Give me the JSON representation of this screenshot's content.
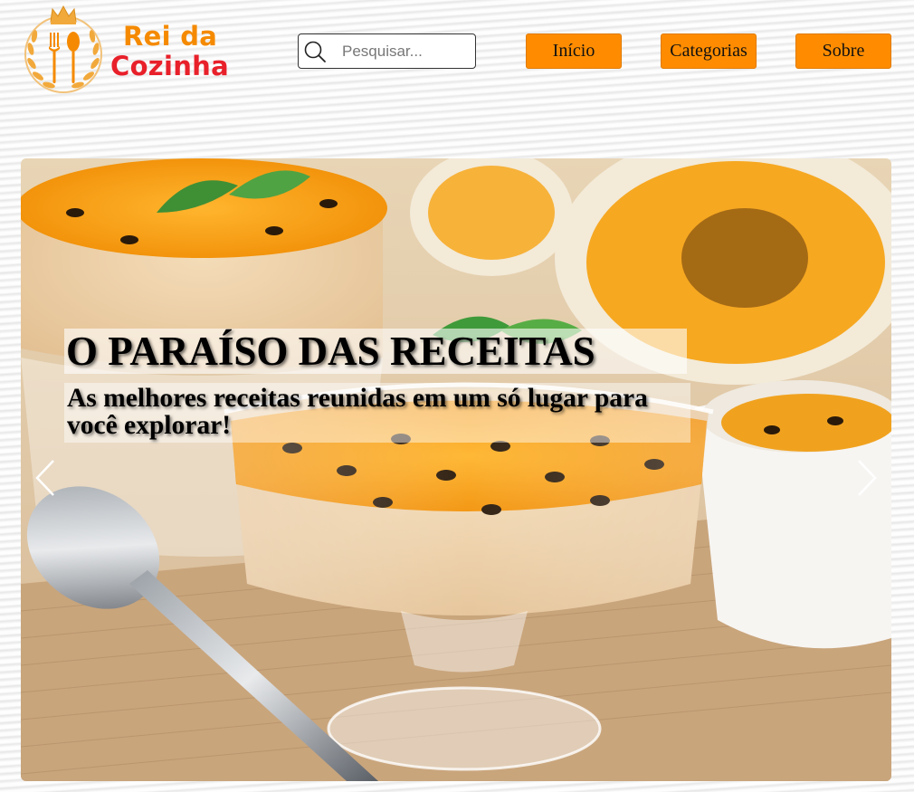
{
  "header": {
    "logo": {
      "line1": "Rei da",
      "line2": "Cozinha"
    },
    "search": {
      "placeholder": "Pesquisar..."
    },
    "nav": {
      "inicio": "Início",
      "categorias": "Categorias",
      "sobre": "Sobre"
    }
  },
  "hero": {
    "title": "O PARAÍSO DAS RECEITAS",
    "subtitle": "As melhores receitas reunidas em um só lugar para você explorar!",
    "prev_icon": "chevron-left-icon",
    "next_icon": "chevron-right-icon"
  },
  "colors": {
    "accent": "#ff8c00",
    "logo_orange": "#f58a00",
    "logo_red": "#e8202a",
    "emblem_gold": "#f2a93b"
  },
  "icons": {
    "search": "search-icon",
    "logo": "crown-fork-spoon-emblem-icon"
  }
}
